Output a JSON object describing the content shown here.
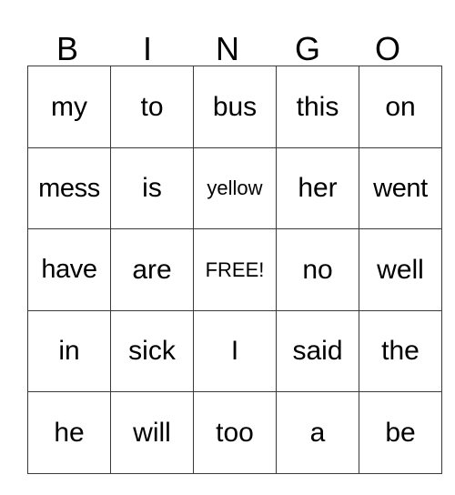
{
  "card": {
    "headers": [
      "B",
      "I",
      "N",
      "G",
      "O"
    ],
    "rows": [
      [
        {
          "text": "my",
          "size": "normal"
        },
        {
          "text": "to",
          "size": "normal"
        },
        {
          "text": "bus",
          "size": "normal"
        },
        {
          "text": "this",
          "size": "normal"
        },
        {
          "text": "on",
          "size": "normal"
        }
      ],
      [
        {
          "text": "mess",
          "size": "tight"
        },
        {
          "text": "is",
          "size": "normal"
        },
        {
          "text": "yellow",
          "size": "shrink"
        },
        {
          "text": "her",
          "size": "normal"
        },
        {
          "text": "went",
          "size": "tight"
        }
      ],
      [
        {
          "text": "have",
          "size": "tight"
        },
        {
          "text": "are",
          "size": "normal"
        },
        {
          "text": "FREE!",
          "size": "shrink"
        },
        {
          "text": "no",
          "size": "normal"
        },
        {
          "text": "well",
          "size": "normal"
        }
      ],
      [
        {
          "text": "in",
          "size": "normal"
        },
        {
          "text": "sick",
          "size": "normal"
        },
        {
          "text": "I",
          "size": "normal"
        },
        {
          "text": "said",
          "size": "normal"
        },
        {
          "text": "the",
          "size": "normal"
        }
      ],
      [
        {
          "text": "he",
          "size": "normal"
        },
        {
          "text": "will",
          "size": "normal"
        },
        {
          "text": "too",
          "size": "normal"
        },
        {
          "text": "a",
          "size": "normal"
        },
        {
          "text": "be",
          "size": "normal"
        }
      ]
    ],
    "free_space": {
      "row": 2,
      "col": 2,
      "label": "FREE!"
    },
    "colors": {
      "background": "#ffffff",
      "text": "#000000",
      "grid_line": "#3a3a3a"
    }
  }
}
